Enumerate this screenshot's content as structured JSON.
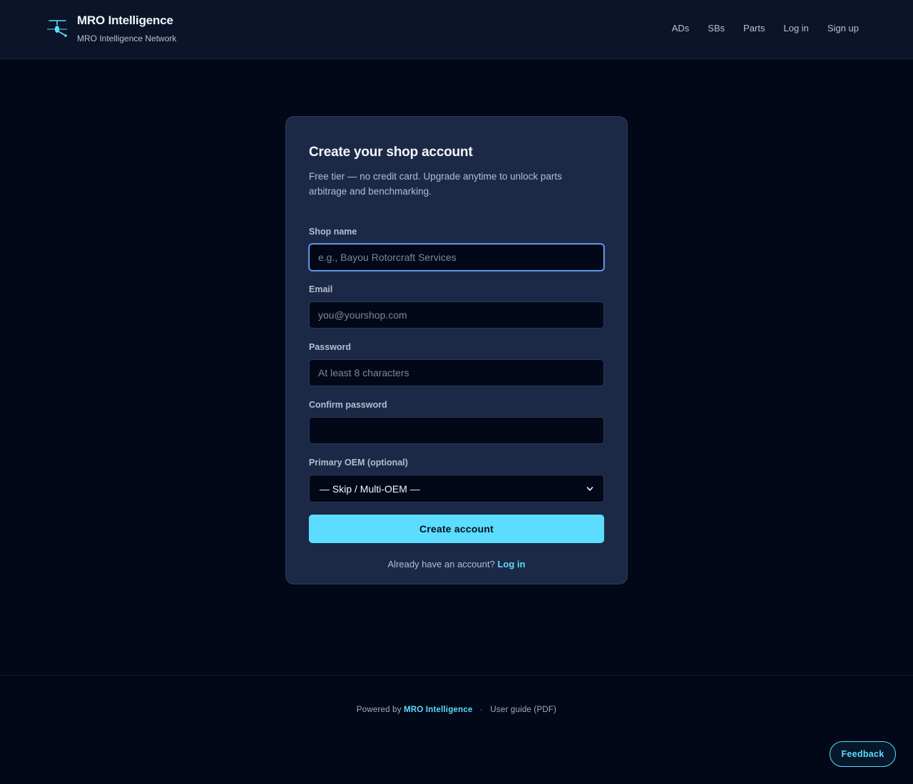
{
  "header": {
    "brand_title": "MRO Intelligence",
    "brand_subtitle": "MRO Intelligence Network",
    "logo_icon": "helicopter-icon",
    "nav": [
      {
        "label": "ADs"
      },
      {
        "label": "SBs"
      },
      {
        "label": "Parts"
      },
      {
        "label": "Log in"
      },
      {
        "label": "Sign up"
      }
    ]
  },
  "form": {
    "title": "Create your shop account",
    "description": "Free tier — no credit card. Upgrade anytime to unlock parts arbitrage and benchmarking.",
    "shop_name": {
      "label": "Shop name",
      "placeholder": "e.g., Bayou Rotorcraft Services",
      "value": ""
    },
    "email": {
      "label": "Email",
      "placeholder": "you@yourshop.com",
      "value": ""
    },
    "password": {
      "label": "Password",
      "placeholder": "At least 8 characters",
      "value": ""
    },
    "confirm_password": {
      "label": "Confirm password",
      "placeholder": "",
      "value": ""
    },
    "primary_oem": {
      "label": "Primary OEM (optional)",
      "selected": "— Skip / Multi-OEM —"
    },
    "submit_label": "Create account",
    "login_prompt": "Already have an account?",
    "login_link": "Log in"
  },
  "footer": {
    "powered_by": "Powered by",
    "brand_link": "MRO Intelligence",
    "separator": "·",
    "guide_link": "User guide (PDF)"
  },
  "feedback_label": "Feedback",
  "colors": {
    "accent": "#5cdcff",
    "background": "#020817",
    "card": "#1c2946",
    "header": "#0b1428"
  }
}
